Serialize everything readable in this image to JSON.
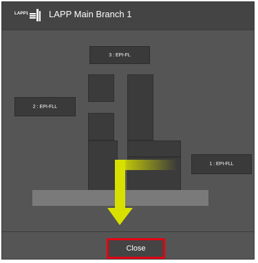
{
  "header": {
    "brand_text": "LAPP1",
    "title": "LAPP Main Branch 1"
  },
  "diagram": {
    "labels": {
      "top": "3 : EPI-FL",
      "left": "2 : EPI-FLL",
      "right": "1 : EPI-FLL"
    },
    "colors": {
      "background": "#555555",
      "block": "#3b3b3b",
      "ground": "#7a7a7a",
      "arrow": "#d8e000"
    }
  },
  "footer": {
    "close_label": "Close",
    "highlight_color": "#e60012"
  }
}
